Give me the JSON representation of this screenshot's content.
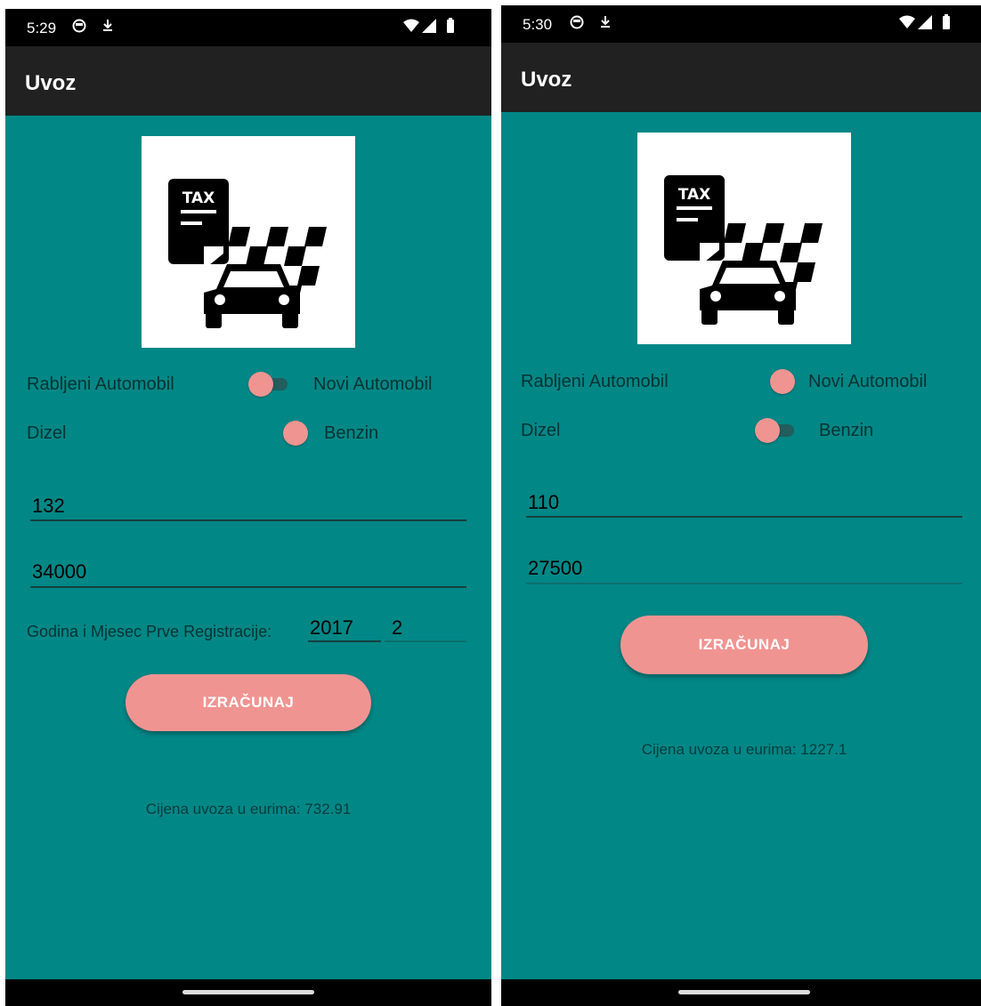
{
  "screens": [
    {
      "status_time": "5:29",
      "title": "Uvoz",
      "logo_text": "TAX",
      "switch1": {
        "left_label": "Rabljeni Automobil",
        "right_label": "Novi Automobil",
        "on": false
      },
      "switch2": {
        "left_label": "Dizel",
        "right_label": "Benzin",
        "on": false
      },
      "field1_value": "132",
      "field2_value": "34000",
      "reg_label": "Godina i Mjesec Prve Registracije:",
      "reg_year": "2017",
      "reg_month": "2",
      "button_label": "IZRAČUNAJ",
      "result": "Cijena uvoza u eurima: 732.91"
    },
    {
      "status_time": "5:30",
      "title": "Uvoz",
      "logo_text": "TAX",
      "switch1": {
        "left_label": "Rabljeni Automobil",
        "right_label": "Novi Automobil",
        "on": false
      },
      "switch2": {
        "left_label": "Dizel",
        "right_label": "Benzin",
        "on": false
      },
      "field1_value": "110",
      "field2_value": "27500",
      "button_label": "IZRAČUNAJ",
      "result": "Cijena uvoza u eurima: 1227.1"
    }
  ],
  "colors": {
    "background": "#008786",
    "accent": "#f09492",
    "appbar": "#212121",
    "status_bar": "#000000"
  },
  "icons": [
    "taxi-tax-logo-icon",
    "wifi-icon",
    "cell-signal-icon",
    "battery-icon",
    "notification-icon",
    "download-icon"
  ]
}
